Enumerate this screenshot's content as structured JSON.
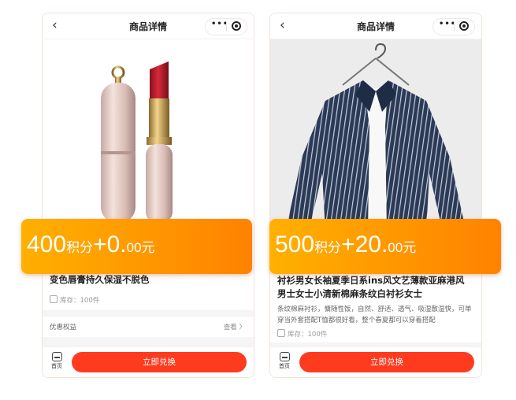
{
  "screens": [
    {
      "nav_title": "商品详情",
      "price": {
        "points_value": "400",
        "points_unit": "积分",
        "plus_int": "+0.",
        "decimals": "00",
        "currency": "元"
      },
      "product_name": "变色唇膏持久保湿不脱色",
      "description": "",
      "stock_label": "库存：100件",
      "benefit_label": "优惠权益",
      "benefit_view": "查看 〉",
      "home_label": "首页",
      "redeem_button": "立即兑换"
    },
    {
      "nav_title": "商品详情",
      "price": {
        "points_value": "500",
        "points_unit": "积分",
        "plus_int": "+20.",
        "decimals": "00",
        "currency": "元"
      },
      "product_name": "衬衫男女长袖夏季日系ins风文艺薄款亚麻港风男士女士小清新棉麻条纹白衬衫女士",
      "description": "条纹棉麻衬衫，慵随性饭，自然、舒适、透气、吸湿散湿快，可单穿当外套搭配T恤都很好看，整个春夏都可以穿着搭配",
      "stock_label": "库存：100件",
      "home_label": "首页",
      "redeem_button": "立即兑换"
    }
  ],
  "colors": {
    "accent_orange": "#ff9700",
    "button_red": "#ff3b1f"
  }
}
